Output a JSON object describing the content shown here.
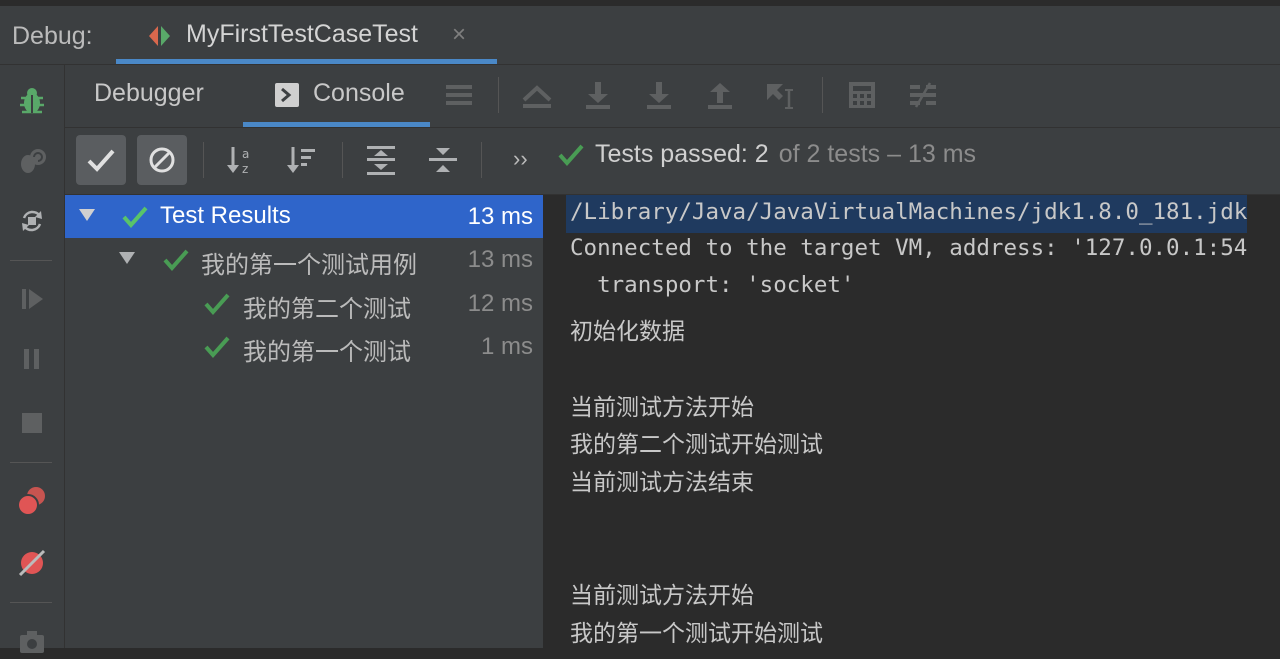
{
  "window": {
    "debug_label": "Debug:",
    "tab_name": "MyFirstTestCaseTest",
    "tab_close": "×"
  },
  "subtabs": {
    "debugger": "Debugger",
    "console": "Console"
  },
  "testbar": {
    "more": "››",
    "status_passed": "Tests passed: 2",
    "status_rest": "of 2 tests – 13 ms"
  },
  "tree": {
    "rows": [
      {
        "label": "Test Results",
        "time": "13 ms"
      },
      {
        "label": "我的第一个测试用例",
        "time": "13 ms"
      },
      {
        "label": "我的第二个测试",
        "time": "12 ms"
      },
      {
        "label": "我的第一个测试",
        "time": "1 ms"
      }
    ]
  },
  "console": {
    "lines": [
      "/Library/Java/JavaVirtualMachines/jdk1.8.0_181.jdk",
      "Connected to the target VM, address: '127.0.0.1:54",
      "  transport: 'socket'",
      "初始化数据",
      "当前测试方法开始",
      "我的第二个测试开始测试",
      "当前测试方法结束",
      "当前测试方法开始",
      "我的第一个测试开始测试"
    ]
  },
  "colors": {
    "accent": "#4a88c7",
    "selection": "#2f65ca",
    "pass_green": "#499c54",
    "debug_green": "#59a869",
    "breakpoint_red": "#e05555"
  },
  "icons": {
    "left_toolbar": [
      "debug-bug-icon",
      "rerun-failed-icon",
      "restart-icon",
      "resume-icon",
      "pause-icon",
      "stop-icon",
      "view-breakpoints-icon",
      "mute-breakpoints-icon",
      "camera-icon"
    ],
    "step_toolbar": [
      "show-execution-point-icon",
      "step-over-icon",
      "step-into-icon",
      "force-step-into-icon",
      "step-out-icon",
      "run-to-cursor-icon",
      "evaluate-expression-icon",
      "trace-icon"
    ],
    "test_toolbar": [
      "show-passed-icon",
      "show-ignored-icon",
      "sort-alphabetically-icon",
      "sort-by-duration-icon",
      "expand-all-icon",
      "collapse-all-icon"
    ]
  }
}
